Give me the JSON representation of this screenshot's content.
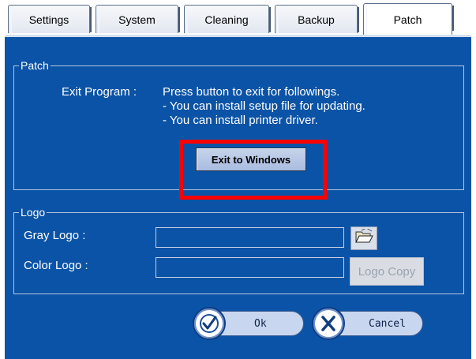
{
  "tabs": [
    {
      "label": "Settings"
    },
    {
      "label": "System"
    },
    {
      "label": "Cleaning"
    },
    {
      "label": "Backup"
    },
    {
      "label": "Patch",
      "active": true
    }
  ],
  "patch": {
    "legend": "Patch",
    "exit_label": "Exit Program :",
    "lines": [
      "Press button to exit for followings.",
      "- You can install setup file for updating.",
      "- You can install printer driver."
    ],
    "exit_button": "Exit to Windows",
    "highlight_color": "#ff0000"
  },
  "logo": {
    "legend": "Logo",
    "gray_label": "Gray Logo :",
    "gray_value": "",
    "color_label": "Color Logo :",
    "color_value": "",
    "browse_icon": "folder-open-icon",
    "copy_button": "Logo Copy"
  },
  "actions": {
    "ok_label": "Ok",
    "ok_icon": "check-icon",
    "cancel_label": "Cancel",
    "cancel_icon": "x-icon"
  },
  "colors": {
    "panel_bg": "#0b53a6",
    "tab_bg": "#e2e7f0"
  }
}
